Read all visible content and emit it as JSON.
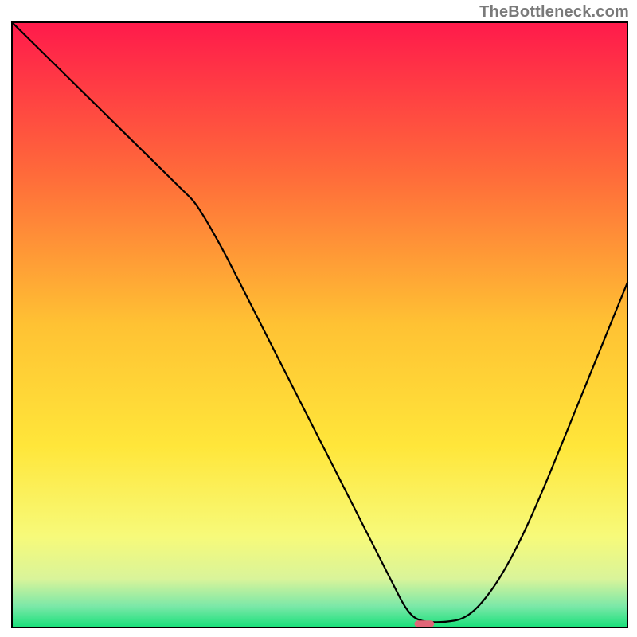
{
  "watermark": "TheBottleneck.com",
  "chart_data": {
    "type": "line",
    "title": "",
    "xlabel": "",
    "ylabel": "",
    "xlim": [
      0,
      100
    ],
    "ylim": [
      0,
      100
    ],
    "grid": false,
    "legend": false,
    "background_gradient": {
      "stops": [
        {
          "offset": 0.0,
          "color": "#ff1a4b"
        },
        {
          "offset": 0.25,
          "color": "#ff6a3a"
        },
        {
          "offset": 0.5,
          "color": "#ffc233"
        },
        {
          "offset": 0.7,
          "color": "#ffe63a"
        },
        {
          "offset": 0.85,
          "color": "#f7fa7a"
        },
        {
          "offset": 0.92,
          "color": "#d9f49a"
        },
        {
          "offset": 0.965,
          "color": "#7be8a8"
        },
        {
          "offset": 1.0,
          "color": "#18e07a"
        }
      ]
    },
    "series": [
      {
        "name": "bottleneck-curve",
        "color": "#000000",
        "x": [
          0.0,
          4,
          8,
          12,
          16,
          20,
          24,
          28,
          30,
          34,
          38,
          42,
          46,
          50,
          54,
          58,
          60,
          62,
          64,
          66,
          70,
          74,
          78,
          82,
          86,
          90,
          94,
          98,
          100
        ],
        "y": [
          100,
          96,
          92,
          88,
          84,
          80,
          76,
          72,
          70,
          63,
          55,
          47,
          39,
          31,
          23,
          15,
          11,
          7,
          3,
          1,
          0.8,
          1.5,
          6,
          13,
          22,
          32,
          42,
          52,
          57
        ]
      }
    ],
    "marker": {
      "name": "highlight-pill",
      "color": "#e06677",
      "x": 67,
      "y": 0.6,
      "width_x_units": 3.2,
      "height_y_units": 1.1
    },
    "frame": {
      "color": "#000000",
      "width": 2
    }
  }
}
